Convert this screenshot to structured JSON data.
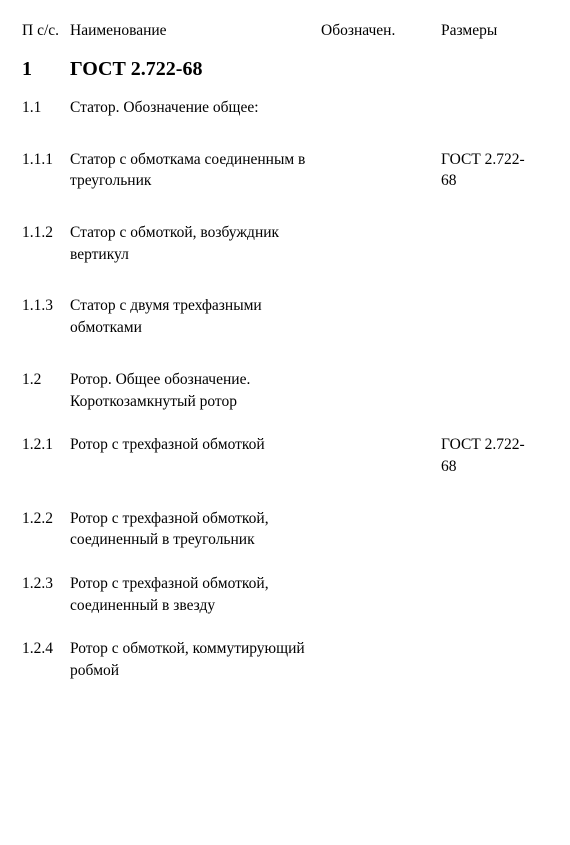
{
  "header": {
    "num": "П с/с.",
    "name": "Наименование",
    "designation": "Обозначен.",
    "size": "Размеры"
  },
  "rows": [
    {
      "num": "1",
      "name": "ГОСТ 2.722-68",
      "size": "",
      "style": "section-1"
    },
    {
      "num": "1.1",
      "name": "Статор. Обозначение общее:",
      "size": ""
    },
    {
      "num": "1.1.1",
      "name": "Статор с обмоткама соединенным в треугольник",
      "size": "ГОСТ 2.722-68"
    },
    {
      "num": "1.1.2",
      "name": "Статор с обмоткой, возбуждник вертикул",
      "size": ""
    },
    {
      "num": "1.1.3",
      "name": "Статор с двумя трехфазными обмотками",
      "size": ""
    },
    {
      "num": "1.2",
      "name": "Ротор. Общее обозначение. Короткозамкнутый ротор",
      "size": "",
      "style": "tight"
    },
    {
      "num": "1.2.1",
      "name": "Ротор с трехфазной обмоткой",
      "size": "ГОСТ 2.722-68"
    },
    {
      "num": "1.2.2",
      "name": "Ротор с трехфазной обмоткой, соединенный в треугольник",
      "size": "",
      "style": "tight"
    },
    {
      "num": "1.2.3",
      "name": "Ротор с трехфазной обмоткой, соединенный в звезду",
      "size": "",
      "style": "tight"
    },
    {
      "num": "1.2.4",
      "name": "Ротор с обмоткой, коммутирующий робмой",
      "size": "",
      "style": "tight"
    }
  ]
}
